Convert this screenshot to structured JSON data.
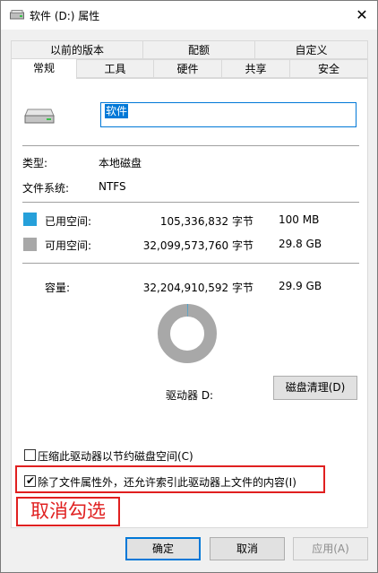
{
  "window": {
    "title": "软件 (D:) 属性",
    "close_glyph": "✕"
  },
  "tabs_top": [
    {
      "label": "以前的版本"
    },
    {
      "label": "配额"
    },
    {
      "label": "自定义"
    }
  ],
  "tabs_bottom": [
    {
      "label": "常规",
      "active": true
    },
    {
      "label": "工具"
    },
    {
      "label": "硬件"
    },
    {
      "label": "共享"
    },
    {
      "label": "安全"
    }
  ],
  "general": {
    "name_value": "软件",
    "type_label": "类型:",
    "type_value": "本地磁盘",
    "fs_label": "文件系统:",
    "fs_value": "NTFS",
    "used": {
      "label": "已用空间:",
      "bytes": "105,336,832 字节",
      "size": "100 MB",
      "color": "#26a0da"
    },
    "free": {
      "label": "可用空间:",
      "bytes": "32,099,573,760 字节",
      "size": "29.8 GB",
      "color": "#a8a8a8"
    },
    "capacity": {
      "label": "容量:",
      "bytes": "32,204,910,592 字节",
      "size": "29.9 GB"
    },
    "drive_label": "驱动器 D:",
    "cleanup_button": "磁盘清理(D)",
    "compress_label": "压缩此驱动器以节约磁盘空间(C)",
    "compress_checked": false,
    "index_label": "除了文件属性外，还允许索引此驱动器上文件的内容(I)",
    "index_checked": true,
    "usage": {
      "used_fraction": 0.003
    }
  },
  "annotation": {
    "text": "取消勾选",
    "color": "#e02020"
  },
  "footer": {
    "ok": "确定",
    "cancel": "取消",
    "apply": "应用(A)"
  },
  "icons": {
    "title": "drive-icon",
    "drive": "drive-icon",
    "check": "checkmark-icon",
    "close": "close-icon"
  }
}
